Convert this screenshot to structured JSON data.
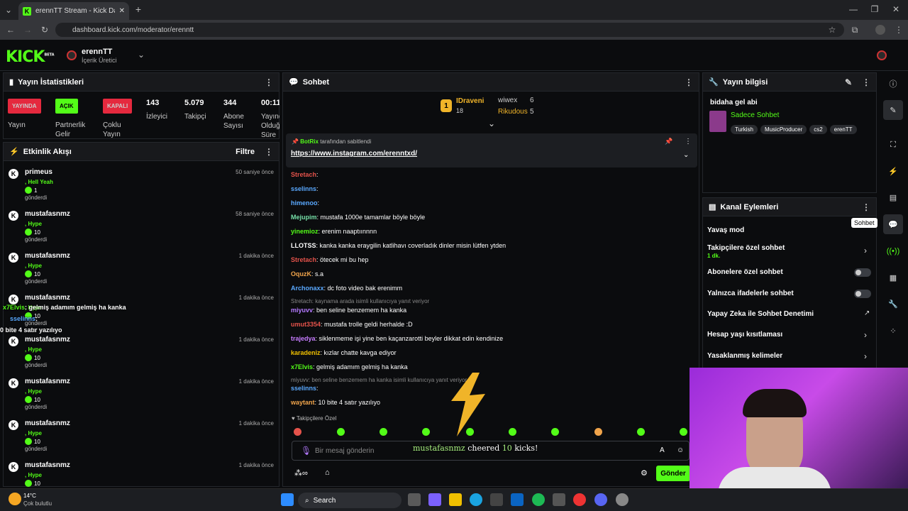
{
  "browser": {
    "tab_title": "erennTT Stream - Kick Dashboard",
    "tab_close": "✕",
    "new_tab": "+",
    "url": "dashboard.kick.com/moderator/erenntt"
  },
  "kick": {
    "logo": "KICK",
    "beta": "BETA",
    "channel_name": "erennTT",
    "channel_role": "İçerik Üretici"
  },
  "stats": {
    "title": "Yayın İstatistikleri",
    "live_badge": "YAYINDA",
    "live_label": "Yayın",
    "partner_badge": "AÇIK",
    "partner_label": "Partnerlik Gelir Programı",
    "multi_badge": "KAPALI",
    "multi_label": "Çoklu Yayın",
    "viewers": "143",
    "viewers_label": "İzleyici",
    "followers": "5.079",
    "followers_label": "Takipçi",
    "subs": "344",
    "subs_label": "Abone Sayısı",
    "uptime": "00:11",
    "uptime_label": "Yayında Olduğu Süre"
  },
  "activity": {
    "title": "Etkinlik Akışı",
    "filter": "Filtre",
    "sent": "gönderdi",
    "items": [
      {
        "user": "primeus",
        "time": "50 saniye önce",
        "label": ", Hell Yeah",
        "count": "1"
      },
      {
        "user": "mustafasnmz",
        "time": "58 saniye önce",
        "label": ", Hype",
        "count": "10"
      },
      {
        "user": "mustafasnmz",
        "time": "1 dakika önce",
        "label": ", Hype",
        "count": "10"
      },
      {
        "user": "mustafasnmz",
        "time": "1 dakika önce",
        "label": ", Hype",
        "count": "10"
      },
      {
        "user": "mustafasnmz",
        "time": "1 dakika önce",
        "label": ", Hype",
        "count": "10"
      },
      {
        "user": "mustafasnmz",
        "time": "1 dakika önce",
        "label": ", Hype",
        "count": "10"
      },
      {
        "user": "mustafasnmz",
        "time": "1 dakika önce",
        "label": ", Hype",
        "count": "10"
      },
      {
        "user": "mustafasnmz",
        "time": "1 dakika önce",
        "label": ", Hype",
        "count": "10"
      }
    ]
  },
  "overlay": {
    "line1_user": "x7Elvis",
    "line1_text": ": gelmiş adamım gelmiş ha kanka",
    "line2_user": "sselinns",
    "line2_text": ":",
    "line3": "0 bite 4 satır yazılıyo"
  },
  "chat": {
    "title": "Sohbet",
    "leaders": [
      {
        "rank": "1",
        "name": "IDraveni",
        "value": "18"
      },
      {
        "name": "wiwex",
        "value": "6"
      },
      {
        "name": "Rikudous",
        "value": "5"
      }
    ],
    "pinned": {
      "by_user": "BotRix",
      "by_text": "tarafından sabitlendi",
      "link": "https://www.instagram.com/erenntxd/"
    },
    "messages": [
      {
        "user": "Stretach",
        "text": ":",
        "color": "#e5534b"
      },
      {
        "user": "sselinns",
        "text": ":",
        "color": "#5aa9ff"
      },
      {
        "user": "himenoo",
        "text": ":",
        "color": "#5aa9ff"
      },
      {
        "user": "Mejupim",
        "text": ": mustafa 1000e tamamlar böyle böyle",
        "color": "#76e0a8"
      },
      {
        "user": "yinemioz",
        "text": ": erenim naaptıınnnn",
        "color": "#53fc18"
      },
      {
        "user": "LLOTSS",
        "text": ": kanka kanka eraygilin katlihavı coverladık dinler misin lütfen ytden",
        "color": "#ffffff"
      },
      {
        "user": "Stretach",
        "text": ": ötecek mi bu hep",
        "color": "#e5534b"
      },
      {
        "user": "OquzK",
        "text": ": s.a",
        "color": "#f0a44b"
      },
      {
        "user": "Archonaxx",
        "text": ": dc foto video bak erenimm",
        "color": "#5aa9ff"
      },
      {
        "reply": "Stretach: kaynama arada isimli kullanıcıya yanıt veriyor"
      },
      {
        "user": "miyuvv",
        "text": ": ben seline benzemem ha kanka",
        "color": "#b47aff"
      },
      {
        "user": "umut3354",
        "text": ": mustafa trolle geldi herhalde :D",
        "color": "#e5534b"
      },
      {
        "user": "trajedya",
        "text": ": siklenmeme işi yine ben kaçanzarotti beyler dikkat edin kendinize",
        "color": "#c77dff"
      },
      {
        "user": "karadeniz",
        "text": ": kızlar chatte kavga ediyor",
        "color": "#f0c000"
      },
      {
        "user": "x7Elvis",
        "text": ": gelmiş adamım gelmiş ha kanka",
        "color": "#53fc18"
      },
      {
        "reply": "miyuvv: ben seline benzemem ha kanka isimli kullanıcıya yanıt veriyor"
      },
      {
        "user": "sselinns",
        "text": ":",
        "color": "#5aa9ff"
      },
      {
        "user": "waytant",
        "text": ": 10 bite 4 satır yazılıyo",
        "color": "#f0a44b"
      }
    ],
    "followers_only": "Takipçilere Özel",
    "input_placeholder": "Bir mesaj gönderin",
    "cheer": {
      "user": "mustafasnmz",
      "word": "cheered",
      "amount": "10",
      "unit": "kicks!"
    },
    "send": "Gönder"
  },
  "stream_info": {
    "title": "Yayın bilgisi",
    "stream_title": "bidaha gel abi",
    "category": "Sadece Sohbet",
    "tags": [
      "Turkish",
      "MusicProducer",
      "cs2",
      "erenTT"
    ]
  },
  "channel_actions": {
    "title": "Kanal Eylemleri",
    "slow": "Yavaş mod",
    "followers_chat": "Takipçilere özel sohbet",
    "followers_sub": "1 dk.",
    "subs_chat": "Abonelere özel sohbet",
    "emote_chat": "Yalnızca ifadelerle sohbet",
    "ai": "Yapay Zeka ile Sohbet Denetimi",
    "age": "Hesap yaşı kısıtlaması",
    "banned": "Yasaklanmış kelimeler"
  },
  "tooltip": "Sohbet",
  "taskbar": {
    "temp": "14°C",
    "weather": "Çok bulutlu",
    "search": "Search"
  },
  "colors": {
    "accent": "#53fc18",
    "bg": "#0b0c0e"
  }
}
